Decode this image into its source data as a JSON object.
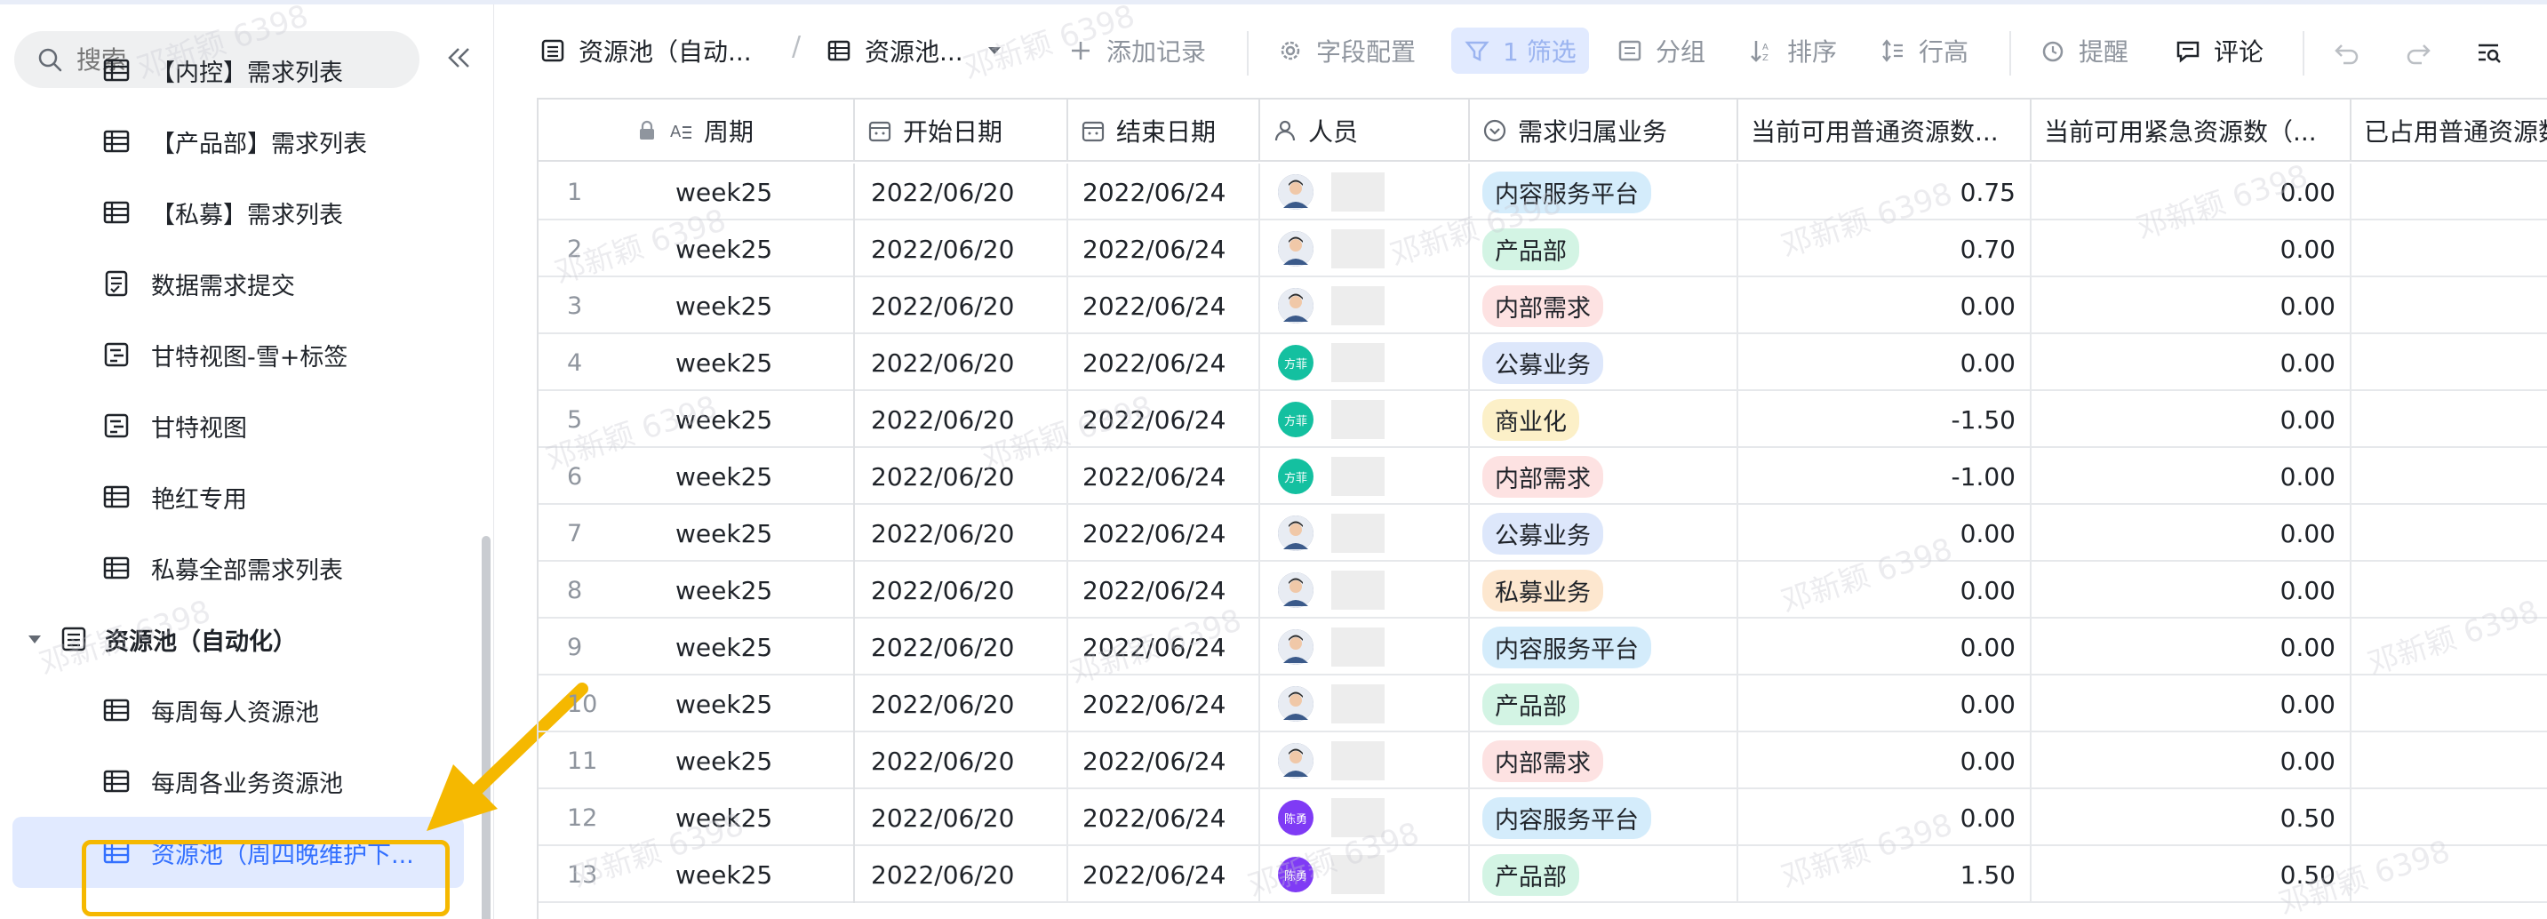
{
  "sidebar": {
    "search_placeholder": "搜索",
    "items": [
      {
        "label": "【内控】需求列表",
        "icon": "grid-table-icon"
      },
      {
        "label": "【产品部】需求列表",
        "icon": "grid-table-icon"
      },
      {
        "label": "【私募】需求列表",
        "icon": "grid-table-icon"
      },
      {
        "label": "数据需求提交",
        "icon": "form-icon"
      },
      {
        "label": "甘特视图-雪+标签",
        "icon": "gantt-icon"
      },
      {
        "label": "甘特视图",
        "icon": "gantt-icon"
      },
      {
        "label": "艳红专用",
        "icon": "grid-table-icon"
      },
      {
        "label": "私募全部需求列表",
        "icon": "grid-table-icon"
      }
    ],
    "parent": {
      "label": "资源池（自动化）",
      "icon": "table-doc-icon"
    },
    "children": [
      {
        "label": "每周每人资源池",
        "icon": "grid-table-icon"
      },
      {
        "label": "每周各业务资源池",
        "icon": "grid-table-icon"
      },
      {
        "label": "资源池（周四晚维护下...",
        "icon": "grid-table-icon",
        "active": true
      }
    ]
  },
  "toolbar": {
    "table_name": "资源池（自动...",
    "view_name": "资源池...",
    "add_record": "添加记录",
    "field_config": "字段配置",
    "filter": "1 筛选",
    "group": "分组",
    "sort": "排序",
    "row_height": "行高",
    "remind": "提醒",
    "comment": "评论"
  },
  "columns": [
    "周期",
    "开始日期",
    "结束日期",
    "人员",
    "需求归属业务",
    "当前可用普通资源数...",
    "当前可用紧急资源数（...",
    "已占用普通资源数"
  ],
  "tag_colors": {
    "内容服务平台": "#d4ecfb",
    "产品部": "#d3f4e4",
    "内部需求": "#fde2e2",
    "公募业务": "#dde7fb",
    "商业化": "#fcf0c8",
    "私募业务": "#fde7cf"
  },
  "avatar_colors": {
    "photo": "#6b7a99",
    "方菲": "#14c0a0",
    "陈勇": "#7f3bf5"
  },
  "rows": [
    {
      "n": "1",
      "week": "week25",
      "start": "2022/06/20",
      "end": "2022/06/24",
      "avatar": "photo",
      "biz": "内容服务平台",
      "normal": "0.75",
      "urgent": "0.00"
    },
    {
      "n": "2",
      "week": "week25",
      "start": "2022/06/20",
      "end": "2022/06/24",
      "avatar": "photo",
      "biz": "产品部",
      "normal": "0.70",
      "urgent": "0.00"
    },
    {
      "n": "3",
      "week": "week25",
      "start": "2022/06/20",
      "end": "2022/06/24",
      "avatar": "photo",
      "biz": "内部需求",
      "normal": "0.00",
      "urgent": "0.00"
    },
    {
      "n": "4",
      "week": "week25",
      "start": "2022/06/20",
      "end": "2022/06/24",
      "avatar": "方菲",
      "biz": "公募业务",
      "normal": "0.00",
      "urgent": "0.00"
    },
    {
      "n": "5",
      "week": "week25",
      "start": "2022/06/20",
      "end": "2022/06/24",
      "avatar": "方菲",
      "biz": "商业化",
      "normal": "-1.50",
      "urgent": "0.00"
    },
    {
      "n": "6",
      "week": "week25",
      "start": "2022/06/20",
      "end": "2022/06/24",
      "avatar": "方菲",
      "biz": "内部需求",
      "normal": "-1.00",
      "urgent": "0.00"
    },
    {
      "n": "7",
      "week": "week25",
      "start": "2022/06/20",
      "end": "2022/06/24",
      "avatar": "photo",
      "biz": "公募业务",
      "normal": "0.00",
      "urgent": "0.00"
    },
    {
      "n": "8",
      "week": "week25",
      "start": "2022/06/20",
      "end": "2022/06/24",
      "avatar": "photo",
      "biz": "私募业务",
      "normal": "0.00",
      "urgent": "0.00"
    },
    {
      "n": "9",
      "week": "week25",
      "start": "2022/06/20",
      "end": "2022/06/24",
      "avatar": "photo",
      "biz": "内容服务平台",
      "normal": "0.00",
      "urgent": "0.00"
    },
    {
      "n": "10",
      "week": "week25",
      "start": "2022/06/20",
      "end": "2022/06/24",
      "avatar": "photo",
      "biz": "产品部",
      "normal": "0.00",
      "urgent": "0.00"
    },
    {
      "n": "11",
      "week": "week25",
      "start": "2022/06/20",
      "end": "2022/06/24",
      "avatar": "photo",
      "biz": "内部需求",
      "normal": "0.00",
      "urgent": "0.00"
    },
    {
      "n": "12",
      "week": "week25",
      "start": "2022/06/20",
      "end": "2022/06/24",
      "avatar": "陈勇",
      "biz": "内容服务平台",
      "normal": "0.00",
      "urgent": "0.50"
    },
    {
      "n": "13",
      "week": "week25",
      "start": "2022/06/20",
      "end": "2022/06/24",
      "avatar": "陈勇",
      "biz": "产品部",
      "normal": "1.50",
      "urgent": "0.50"
    }
  ],
  "watermark": "邓新颖 6398"
}
